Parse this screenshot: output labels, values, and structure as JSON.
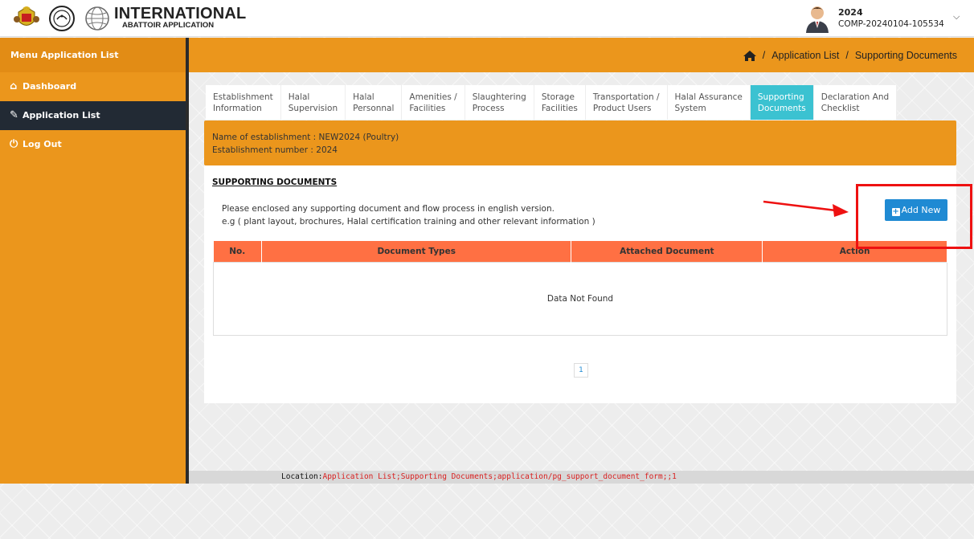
{
  "header": {
    "brand_title": "INTERNATIONAL",
    "brand_subtitle": "ABATTOIR APPLICATION",
    "user_year": "2024",
    "user_id": "COMP-20240104-105534"
  },
  "sidebar": {
    "title": "Menu Application List",
    "items": [
      {
        "label": "Dashboard",
        "icon": "home-icon"
      },
      {
        "label": "Application List",
        "icon": "edit-icon",
        "active": true
      },
      {
        "label": "Log Out",
        "icon": "power-icon"
      }
    ]
  },
  "breadcrumb": {
    "items": [
      "Application List",
      "Supporting Documents"
    ]
  },
  "tabs": [
    {
      "line1": "Establishment",
      "line2": "Information"
    },
    {
      "line1": "Halal",
      "line2": "Supervision"
    },
    {
      "line1": "Halal",
      "line2": "Personnal"
    },
    {
      "line1": "Amenities /",
      "line2": "Facilities"
    },
    {
      "line1": "Slaughtering",
      "line2": "Process"
    },
    {
      "line1": "Storage",
      "line2": "Facilities"
    },
    {
      "line1": "Transportation /",
      "line2": "Product Users"
    },
    {
      "line1": "Halal Assurance",
      "line2": "System"
    },
    {
      "line1": "Supporting",
      "line2": "Documents",
      "active": true
    },
    {
      "line1": "Declaration And",
      "line2": "Checklist"
    }
  ],
  "establishment": {
    "name_line": "Name of establishment : NEW2024 (Poultry)",
    "number_line": "Establishment number  : 2024"
  },
  "section": {
    "title": "SUPPORTING DOCUMENTS",
    "instruction_1": "Please enclosed any supporting document and flow process in english version.",
    "instruction_2": "e.g ( plant layout, brochures, Halal certification training and other relevant information )",
    "add_label": "Add New"
  },
  "table": {
    "columns": [
      "No.",
      "Document Types",
      "Attached Document",
      "Action"
    ],
    "empty_message": "Data Not Found"
  },
  "pagination": {
    "current": "1"
  },
  "location": {
    "label": "Location:",
    "value": "Application List;Supporting Documents;application/pg_support_document_form;;1"
  },
  "colors": {
    "accent_orange": "#eb961c",
    "table_header": "#ff7043",
    "active_tab": "#3bc2d1",
    "button_blue": "#1f8ad3",
    "annotation_red": "#ee1111"
  }
}
